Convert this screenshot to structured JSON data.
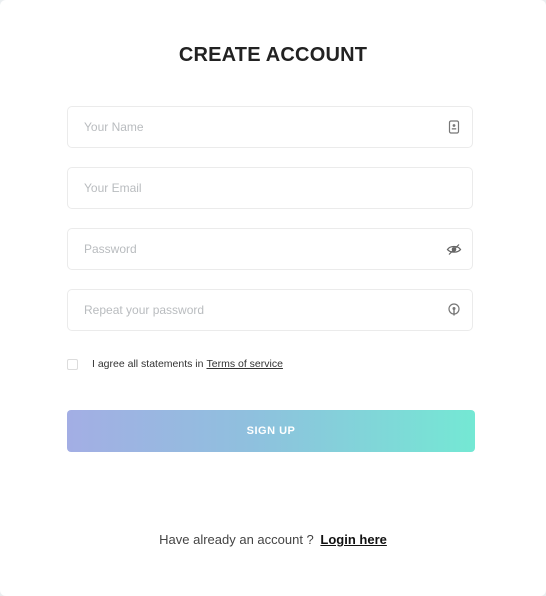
{
  "form": {
    "title": "CREATE ACCOUNT",
    "fields": {
      "name": {
        "placeholder": "Your Name",
        "value": "",
        "icon": "id-card-icon"
      },
      "email": {
        "placeholder": "Your Email",
        "value": ""
      },
      "password": {
        "placeholder": "Password",
        "value": "",
        "icon": "eye-icon"
      },
      "repeat_password": {
        "placeholder": "Repeat your password",
        "value": "",
        "icon": "lock-icon"
      }
    },
    "agree": {
      "text": "I agree all statements in",
      "link": "Terms of service",
      "checked": false
    },
    "submit_label": "SIGN UP",
    "footer": {
      "text": "Have already an account ?",
      "link": "Login here"
    }
  },
  "colors": {
    "gradient_start": "#a3aee4",
    "gradient_end": "#74e8d4",
    "title": "#222222"
  }
}
